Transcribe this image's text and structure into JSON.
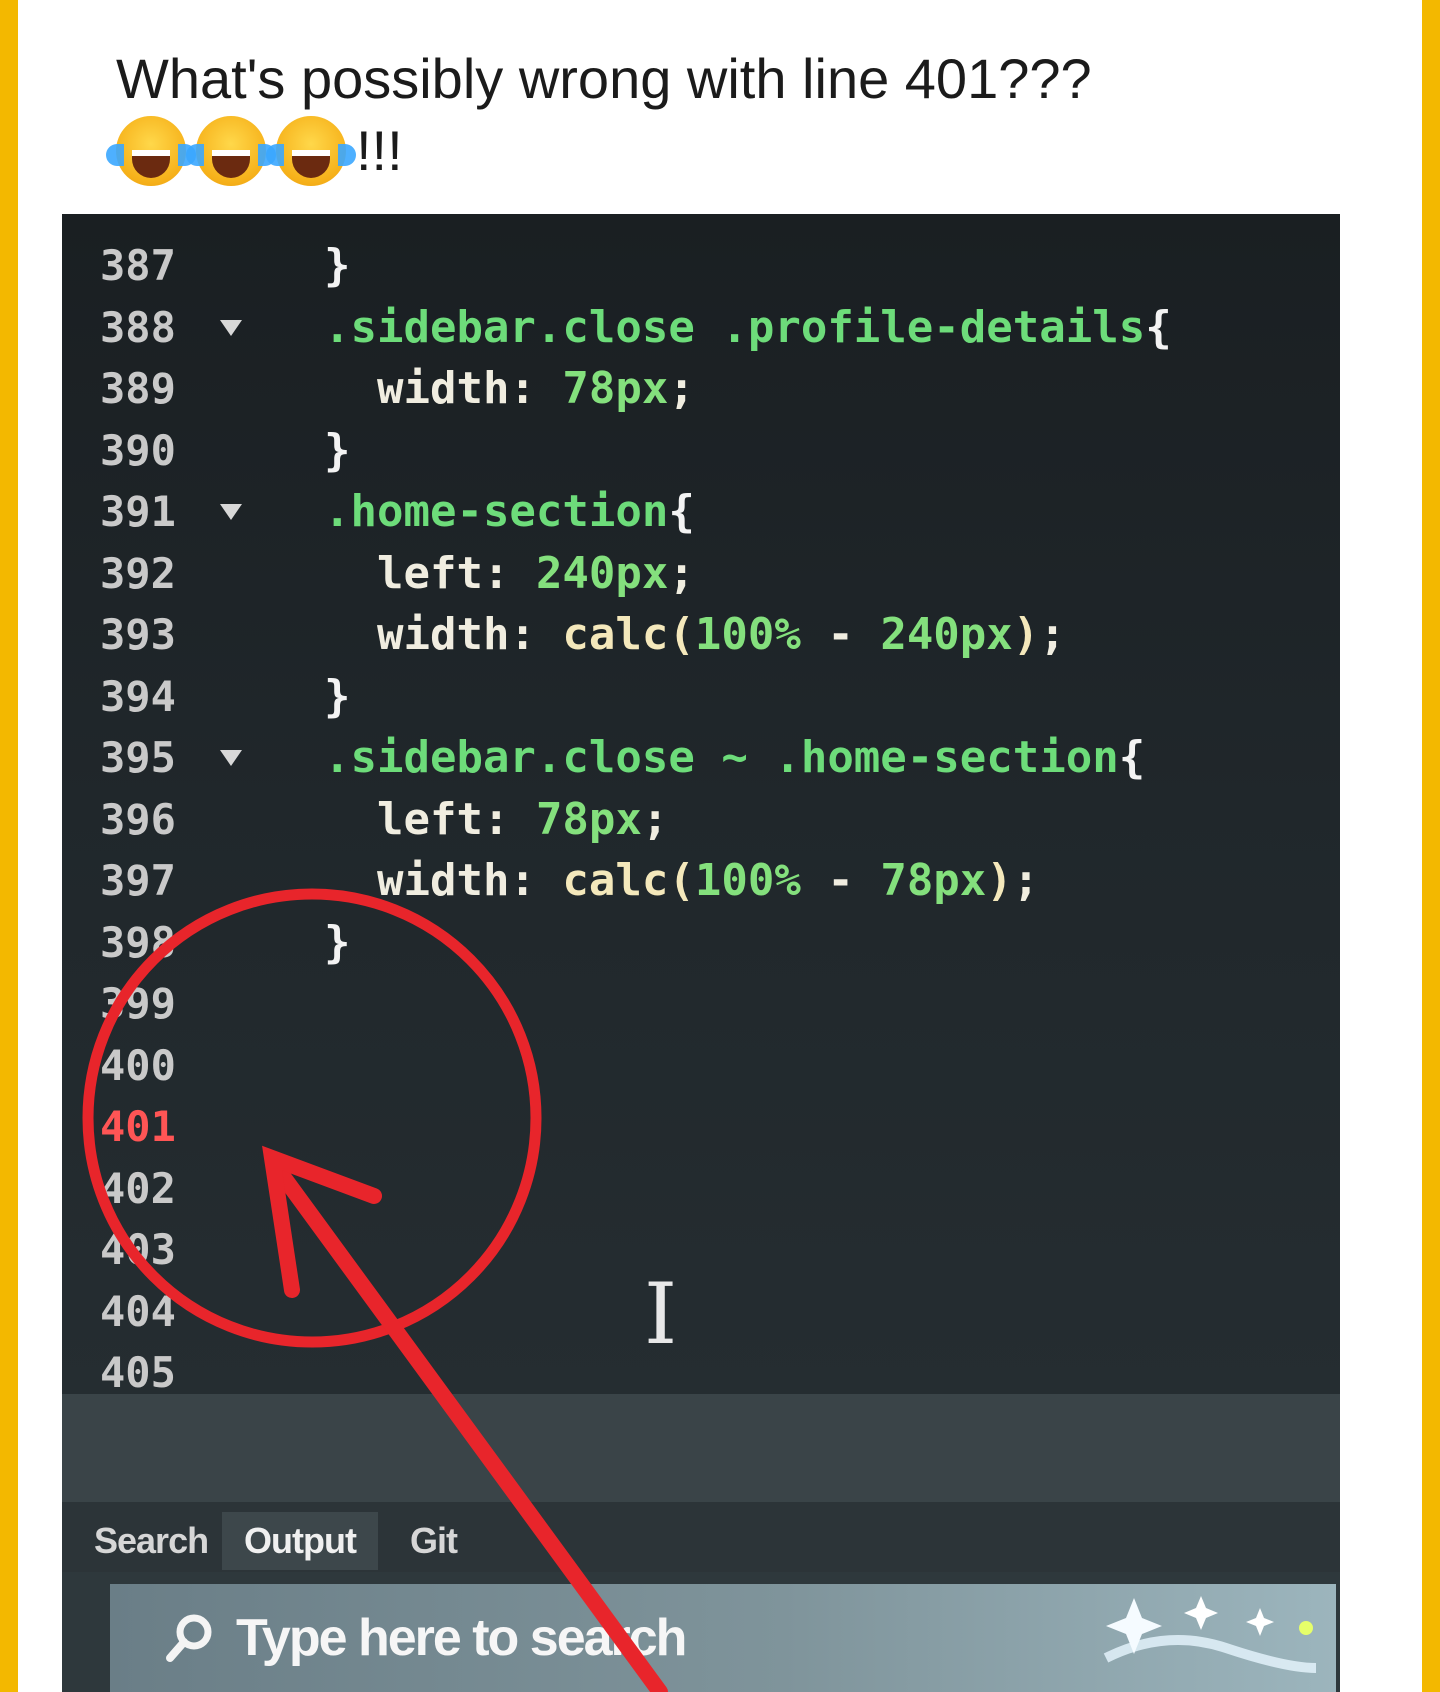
{
  "post": {
    "caption_line1": "What's possibly wrong with line 401???",
    "caption_line2_suffix": "!!!",
    "emoji_icons": [
      "tears-of-joy-emoji",
      "tears-of-joy-emoji",
      "tears-of-joy-emoji"
    ]
  },
  "editor": {
    "lines": [
      {
        "num": "387",
        "fold": false,
        "code": "}"
      },
      {
        "num": "388",
        "fold": true,
        "code": ".sidebar.close .profile-details{"
      },
      {
        "num": "389",
        "fold": false,
        "code": "  width: 78px;"
      },
      {
        "num": "390",
        "fold": false,
        "code": "}"
      },
      {
        "num": "391",
        "fold": true,
        "code": ".home-section{"
      },
      {
        "num": "392",
        "fold": false,
        "code": "  left: 240px;"
      },
      {
        "num": "393",
        "fold": false,
        "code": "  width: calc(100% - 240px);"
      },
      {
        "num": "394",
        "fold": false,
        "code": "}"
      },
      {
        "num": "395",
        "fold": true,
        "code": ".sidebar.close ~ .home-section{"
      },
      {
        "num": "396",
        "fold": false,
        "code": "  left: 78px;"
      },
      {
        "num": "397",
        "fold": false,
        "code": "  width: calc(100% - 78px);"
      },
      {
        "num": "398",
        "fold": false,
        "code": "}"
      },
      {
        "num": "399",
        "fold": false,
        "code": ""
      },
      {
        "num": "400",
        "fold": false,
        "code": ""
      },
      {
        "num": "401",
        "fold": false,
        "code": "",
        "error": true
      },
      {
        "num": "402",
        "fold": false,
        "code": ""
      },
      {
        "num": "403",
        "fold": false,
        "code": ""
      },
      {
        "num": "404",
        "fold": false,
        "code": ""
      },
      {
        "num": "405",
        "fold": false,
        "code": ""
      }
    ]
  },
  "panel": {
    "tabs": [
      {
        "label": "Search",
        "active": false
      },
      {
        "label": "Output",
        "active": true
      },
      {
        "label": "Git",
        "active": false
      }
    ]
  },
  "taskbar": {
    "search_placeholder": "Type here to search"
  },
  "colors": {
    "annotation_red": "#e8252b",
    "error_line_number": "#ff5555",
    "selector_green": "#6ddc7a",
    "frame_yellow": "#f3b800"
  }
}
